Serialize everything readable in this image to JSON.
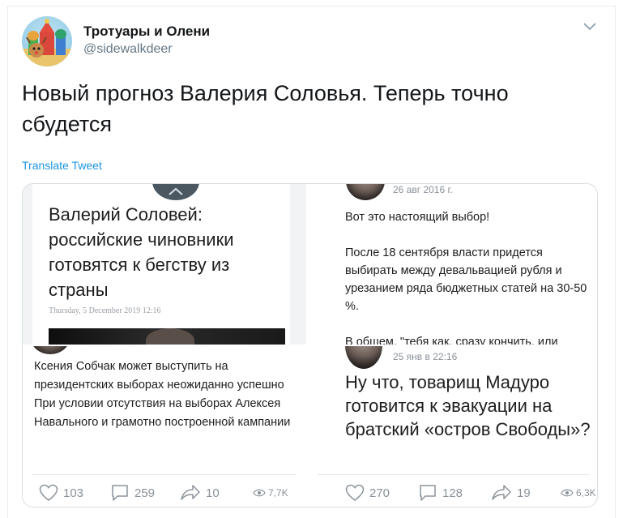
{
  "author": {
    "name": "Тротуары и Олени",
    "handle": "@sidewalkdeer"
  },
  "tweet": {
    "text": "Новый прогноз Валерия Соловья. Теперь точно сбудется",
    "translate_label": "Translate Tweet"
  },
  "media": {
    "panel1": {
      "headline": "Валерий Соловей: российские чиновники готовятся к бегству из страны",
      "date": "Thursday, 5 December 2019 12:16"
    },
    "panel2": {
      "meta": "26 авг 2016 г.",
      "paragraphs": [
        "Вот это настоящий выбор!",
        "После 18 сентября власти придется выбирать между девальвацией рубля и урезанием ряда бюджетных статей на 30-50 %.",
        "В общем, \"тебя как, сразу кончить, или"
      ]
    },
    "panel3": {
      "text": "Ксения Собчак может выступить на президентских выборах неожиданно успешно\nПри условии отсутствия на выборах Алексея Навального и грамотно построенной кампании",
      "stats": {
        "likes": "103",
        "comments": "259",
        "shares": "10",
        "views": "7,7K"
      }
    },
    "panel4": {
      "meta": "25 янв в 22:16",
      "text": "Ну что, товарищ Мадуро готовится к эвакуации на братский «остров Свободы»?",
      "stats": {
        "likes": "270",
        "comments": "128",
        "shares": "19",
        "views": "6,3K"
      }
    }
  },
  "icons": {
    "chevron": "chevron-down-icon",
    "like": "heart-icon",
    "comment": "comment-icon",
    "share": "share-arrow-icon",
    "views": "eye-icon"
  },
  "colors": {
    "link": "#1b95e0",
    "handle": "#657786",
    "muted": "#8a9299"
  }
}
